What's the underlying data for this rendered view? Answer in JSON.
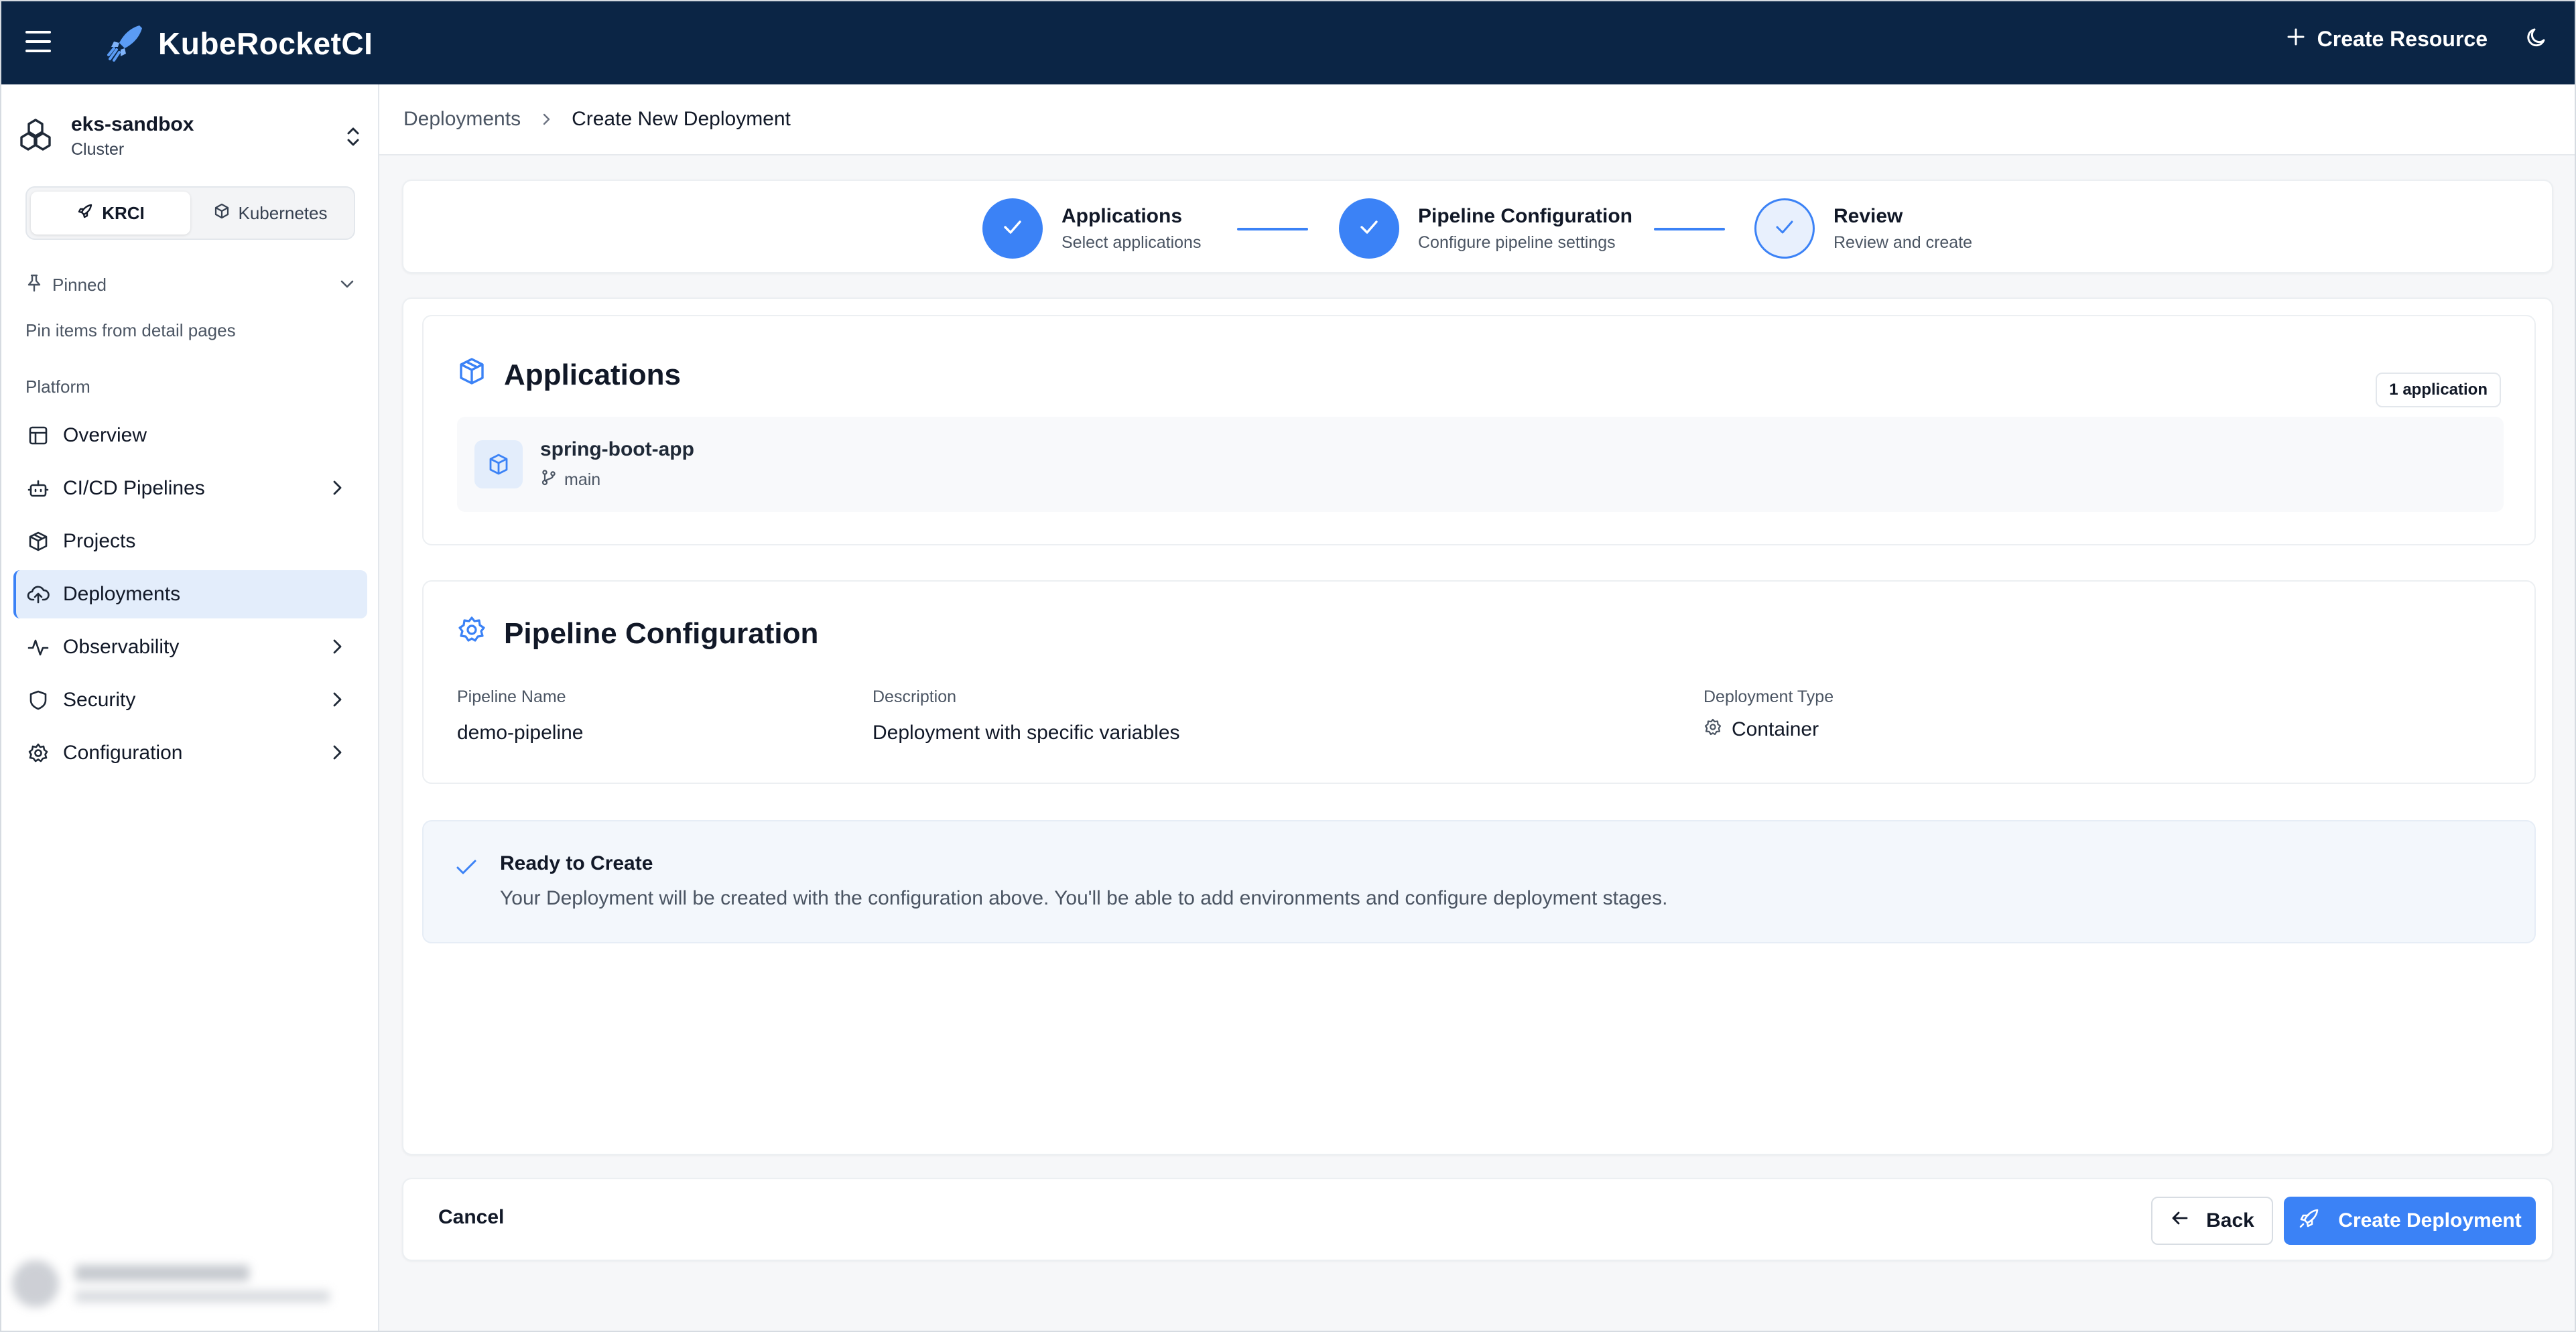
{
  "header": {
    "title": "KubeRocketCI",
    "create_resource": "Create Resource",
    "icons": [
      "menu-icon",
      "rocket-logo-icon",
      "plus-icon",
      "moon-icon"
    ]
  },
  "sidebar": {
    "cluster": {
      "name": "eks-sandbox",
      "type": "Cluster"
    },
    "segments": [
      {
        "label": "KRCI",
        "active": true
      },
      {
        "label": "Kubernetes",
        "active": false
      }
    ],
    "pinned": {
      "label": "Pinned",
      "hint": "Pin items from detail pages"
    },
    "section": "Platform",
    "items": [
      {
        "label": "Overview",
        "icon": "layout-icon",
        "chevron": false
      },
      {
        "label": "CI/CD Pipelines",
        "icon": "bot-icon",
        "chevron": true
      },
      {
        "label": "Projects",
        "icon": "box-icon",
        "chevron": false
      },
      {
        "label": "Deployments",
        "icon": "cloud-upload-icon",
        "chevron": false,
        "active": true
      },
      {
        "label": "Observability",
        "icon": "activity-icon",
        "chevron": true
      },
      {
        "label": "Security",
        "icon": "shield-icon",
        "chevron": true
      },
      {
        "label": "Configuration",
        "icon": "gear-icon",
        "chevron": true
      }
    ]
  },
  "breadcrumb": {
    "parent": "Deployments",
    "current": "Create New Deployment"
  },
  "stepper": {
    "steps": [
      {
        "title": "Applications",
        "desc": "Select applications",
        "state": "complete"
      },
      {
        "title": "Pipeline Configuration",
        "desc": "Configure pipeline settings",
        "state": "complete"
      },
      {
        "title": "Review",
        "desc": "Review and create",
        "state": "current"
      }
    ]
  },
  "applications": {
    "title": "Applications",
    "badge": "1 application",
    "items": [
      {
        "name": "spring-boot-app",
        "branch": "main"
      }
    ]
  },
  "pipeline": {
    "title": "Pipeline Configuration",
    "name_label": "Pipeline Name",
    "name": "demo-pipeline",
    "desc_label": "Description",
    "desc": "Deployment with specific variables",
    "type_label": "Deployment Type",
    "type": "Container"
  },
  "ready": {
    "title": "Ready to Create",
    "text": "Your Deployment will be created with the configuration above. You'll be able to add environments and configure deployment stages."
  },
  "footer": {
    "cancel": "Cancel",
    "back": "Back",
    "create": "Create Deployment"
  },
  "colors": {
    "topbar": "#0b2545",
    "accent": "#3b82f6",
    "active_bg": "#e3edfb"
  }
}
